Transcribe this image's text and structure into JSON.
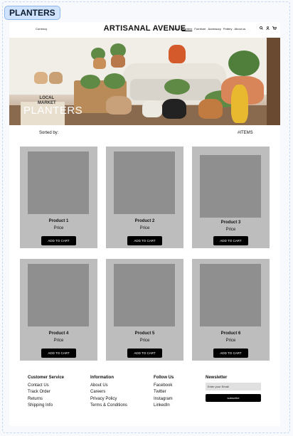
{
  "tag": "PLANTERS",
  "header": {
    "currency": "Currency",
    "brand": "ARTISANAL AVENUE",
    "nav": [
      "Home",
      "Planters",
      "Furniture",
      "Accessory",
      "Pottery",
      "About us"
    ],
    "active_nav": "Planters",
    "icons": [
      "search-icon",
      "user-icon",
      "cart-icon"
    ]
  },
  "hero": {
    "title": "PLANTERS",
    "crate_text_1": "LOCAL",
    "crate_text_2": "MARKET"
  },
  "sort": {
    "sorted_label": "Sorted by:",
    "items_label": "#ITEMS"
  },
  "products": [
    {
      "name": "Product 1",
      "price": "Price",
      "button": "ADD TO CART"
    },
    {
      "name": "Product 2",
      "price": "Price",
      "button": "ADD TO CART"
    },
    {
      "name": "Product 3",
      "price": "Price",
      "button": "ADD TO CART"
    },
    {
      "name": "Product 4",
      "price": "Price",
      "button": "ADD TO CART"
    },
    {
      "name": "Product 5",
      "price": "Price",
      "button": "ADD TO CART"
    },
    {
      "name": "Product 6",
      "price": "Price",
      "button": "ADD TO CART"
    }
  ],
  "footer": {
    "customer_service": {
      "title": "Customer Service",
      "links": [
        "Contact Us",
        "Track Order",
        "Returns",
        "Shipping Info"
      ]
    },
    "information": {
      "title": "Information",
      "links": [
        "About Us",
        "Careers",
        "Privacy Policy",
        "Terms & Conditions"
      ]
    },
    "follow_us": {
      "title": "Follow Us",
      "links": [
        "Facebook",
        "Twitter",
        "Instagram",
        "LinkedIn"
      ]
    },
    "newsletter": {
      "title": "Newsletter",
      "placeholder": "Enter your Email",
      "button": "subscribe"
    }
  }
}
